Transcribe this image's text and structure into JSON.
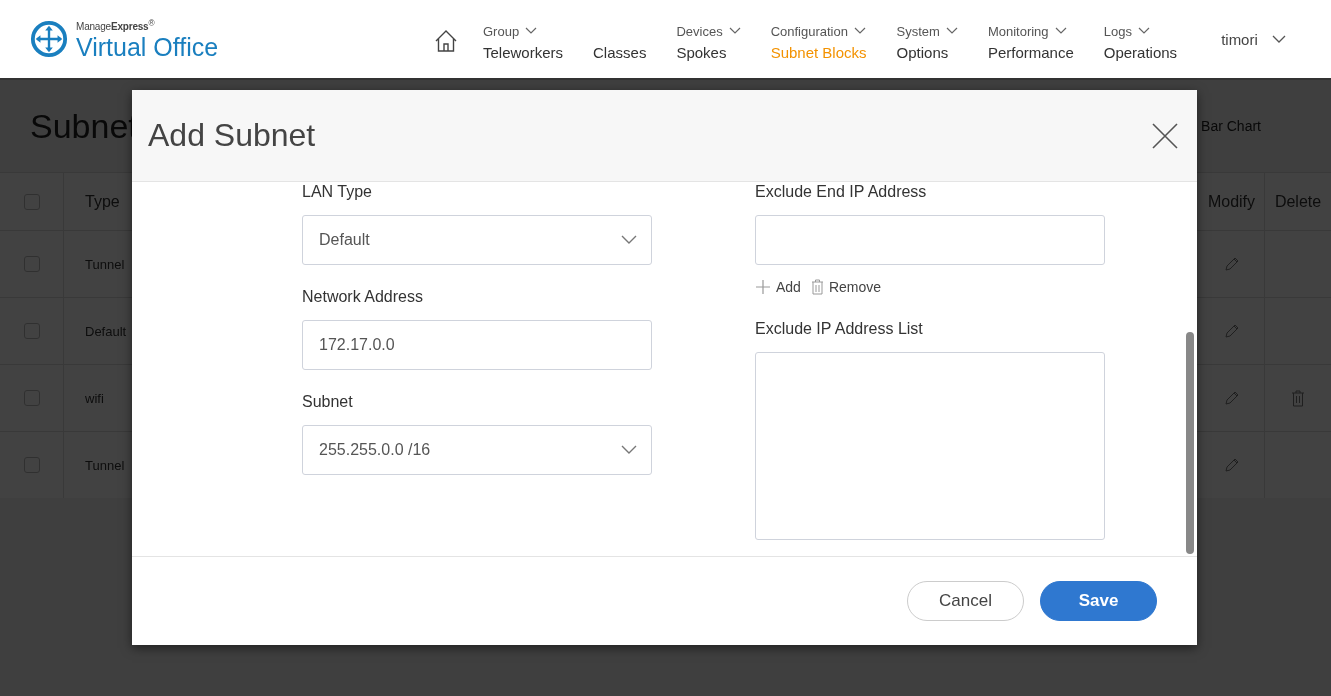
{
  "header": {
    "brand_small": "Manage**Express**$^{®}$",
    "brand": "Virtual Office",
    "nav": [
      {
        "kind": "home",
        "selected": false
      },
      {
        "kind": "link",
        "group": "Group",
        "label": "Teleworkers",
        "selected": false
      },
      {
        "kind": "link",
        "label": "Classes",
        "selected": false
      },
      {
        "kind": "link",
        "group": "Devices",
        "label": "Spokes",
        "selected": false
      },
      {
        "kind": "link",
        "group": "Configuration",
        "label": "Subnet Blocks",
        "selected": true
      },
      {
        "kind": "link",
        "group": "System",
        "label": "Options",
        "selected": false
      },
      {
        "kind": "link",
        "group": "Monitoring",
        "label": "Performance",
        "selected": false
      },
      {
        "kind": "link",
        "group": "Logs",
        "label": "Operations",
        "selected": false
      }
    ],
    "user": "timori"
  },
  "page": {
    "title": "Subnet",
    "view_toggle": "Bar Chart",
    "table": {
      "all_checked": false,
      "columns": [
        "Type",
        "Modify",
        "Delete"
      ],
      "rows": [
        {
          "type": "Tunnel",
          "checked": false,
          "deletable": false
        },
        {
          "type": "Default",
          "checked": false,
          "deletable": false
        },
        {
          "type": "wifi",
          "checked": false,
          "deletable": true
        },
        {
          "type": "Tunnel",
          "checked": false,
          "deletable": false
        }
      ]
    }
  },
  "modal": {
    "title": "Add Subnet",
    "left_fields": [
      {
        "label": "LAN Type",
        "kind": "select",
        "value": "Default"
      },
      {
        "label": "Network Address",
        "kind": "text",
        "value": "172.17.0.0"
      },
      {
        "label": "Subnet",
        "kind": "select",
        "value": "255.255.0.0 /16"
      }
    ],
    "exclude_end": {
      "label": "Exclude End IP Address"
    },
    "add_label": "Add",
    "remove_label": "Remove",
    "exclude_list_label": "Exclude IP Address List",
    "buttons": [
      {
        "kind": "secondary",
        "label": "Cancel"
      },
      {
        "kind": "primary",
        "label": "Save"
      }
    ]
  }
}
